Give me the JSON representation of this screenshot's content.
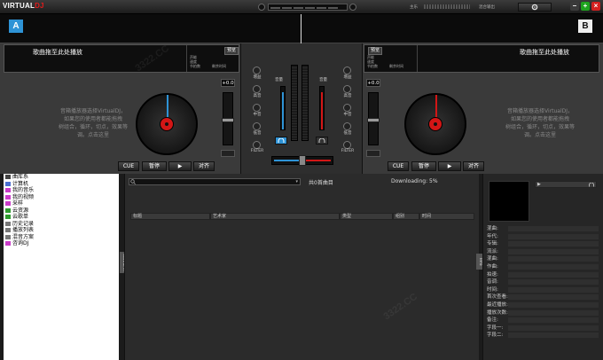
{
  "app": {
    "logo_part1": "VIRTUAL",
    "logo_part2": "DJ",
    "top_left_label": "主乐",
    "top_right_label": "混合输出",
    "min_icon": "minimize-icon",
    "max_icon": "maximize-icon",
    "close_icon": "close-icon"
  },
  "decks": {
    "left": {
      "letter": "A",
      "title": "歌曲拖至此处播放",
      "mini_btn": "预览",
      "mini_rows": [
        "声能",
        "速度",
        "节拍数",
        "剩余时间"
      ],
      "hint": [
        "音箱播放器选择VirtualDJ，",
        "如果您的使用者都能拖拽",
        "树组合，循环，切点，效果等",
        "调。点击这里"
      ],
      "pitch_value": "+0.0",
      "btn_cue": "CUE",
      "btn_pause": "暂停",
      "btn_play": "▶",
      "btn_sync": "对齐"
    },
    "right": {
      "letter": "B",
      "title": "歌曲拖至此处播放",
      "mini_btn": "预览",
      "mini_rows": [
        "声能",
        "速度",
        "节拍数",
        "剩余时间"
      ],
      "hint": [
        "音箱播放器选择VirtualDJ，",
        "如果您的使用者都能拖拽",
        "树组合，循环，切点，效果等",
        "调。点击这里"
      ],
      "pitch_value": "+0.0",
      "btn_cue": "CUE",
      "btn_pause": "暂停",
      "btn_play": "▶",
      "btn_sync": "对齐"
    }
  },
  "mixer": {
    "eq_left": [
      "增益",
      "高音",
      "中音",
      "低音",
      "FILTER"
    ],
    "eq_right": [
      "增益",
      "高音",
      "中音",
      "低音",
      "FILTER"
    ],
    "vol_left": "音量",
    "vol_right": "音量"
  },
  "browser": {
    "search_placeholder": "",
    "count_label": "共0首曲目",
    "downloading": "Downloading: 5%",
    "columns": [
      "标题",
      "艺术家",
      "类型",
      "组别",
      "时间"
    ]
  },
  "tree": [
    {
      "label": "曲库系",
      "color": "#444"
    },
    {
      "label": "计算机",
      "color": "#4a6fd1"
    },
    {
      "label": "我的音乐",
      "color": "#c93bc9"
    },
    {
      "label": "我的视频",
      "color": "#c93bc9"
    },
    {
      "label": "采样",
      "color": "#c93bc9"
    },
    {
      "label": "云资源",
      "color": "#2e9b2e"
    },
    {
      "label": "云歌单",
      "color": "#2e9b2e"
    },
    {
      "label": "历史记录",
      "color": "#777"
    },
    {
      "label": "播放列表",
      "color": "#777"
    },
    {
      "label": "混音方案",
      "color": "#777"
    },
    {
      "label": "咨询DJ",
      "color": "#c93bc9"
    }
  ],
  "info_fields": [
    "混曲:",
    "年代:",
    "专辑:",
    "流派:",
    "混曲:",
    "作曲:",
    "拍速:",
    "音调:",
    "时间:",
    "首次查看:",
    "最近播放:",
    "播放次数:",
    "备注:",
    "字段一:",
    "字段二:"
  ],
  "side_tabs": {
    "left": "SIDEBAR",
    "right": "Info"
  },
  "colors": {
    "deck_a_accent": "#2e93d6",
    "deck_b_accent": "#d21616",
    "brand_red": "#e31b1b"
  }
}
